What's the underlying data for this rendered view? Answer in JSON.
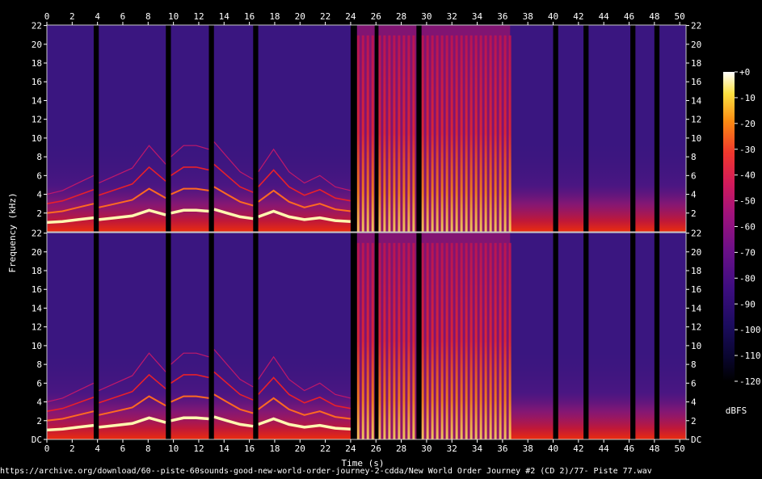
{
  "chart_data": {
    "type": "heatmap",
    "xlabel": "Time (s)",
    "ylabel": "Frequency (kHz)",
    "colorbar_label": "dBFS",
    "xlim": [
      0,
      50.5
    ],
    "ylim": [
      0,
      22.05
    ],
    "x_ticks": [
      "0",
      "2",
      "4",
      "6",
      "8",
      "10",
      "12",
      "14",
      "16",
      "18",
      "20",
      "22",
      "24",
      "26",
      "28",
      "30",
      "32",
      "34",
      "36",
      "38",
      "40",
      "42",
      "44",
      "46",
      "48",
      "50"
    ],
    "y_ticks": [
      "DC",
      "2",
      "4",
      "6",
      "8",
      "10",
      "12",
      "14",
      "16",
      "18",
      "20",
      "22"
    ],
    "colorbar_ticks": [
      "+0",
      "-10",
      "-20",
      "-30",
      "-40",
      "-50",
      "-60",
      "-70",
      "-80",
      "-90",
      "-100",
      "-110",
      "-120"
    ],
    "colorbar_range": [
      -120,
      0
    ],
    "channels": [
      "left",
      "right"
    ],
    "silence_gaps_s": [
      [
        3.7,
        4.1
      ],
      [
        9.4,
        9.8
      ],
      [
        12.8,
        13.2
      ],
      [
        16.3,
        16.7
      ],
      [
        24.0,
        24.5
      ],
      [
        25.9,
        26.2
      ],
      [
        29.2,
        29.6
      ],
      [
        40.0,
        40.4
      ],
      [
        42.4,
        42.8
      ],
      [
        46.1,
        46.5
      ],
      [
        48.0,
        48.4
      ]
    ],
    "pulse_regions_s": [
      [
        24.5,
        25.9
      ],
      [
        26.2,
        29.2
      ],
      [
        29.6,
        36.6
      ]
    ],
    "harmonic_curves": [
      {
        "from_s": 0.0,
        "to_s": 3.7,
        "f0_khz": [
          1.0,
          1.1,
          1.3,
          1.5
        ]
      },
      {
        "from_s": 4.1,
        "to_s": 9.4,
        "f0_khz": [
          1.3,
          1.5,
          1.7,
          2.3,
          1.8
        ]
      },
      {
        "from_s": 9.8,
        "to_s": 12.8,
        "f0_khz": [
          2.0,
          2.3,
          2.3,
          2.2
        ]
      },
      {
        "from_s": 13.2,
        "to_s": 16.3,
        "f0_khz": [
          2.4,
          2.0,
          1.6,
          1.4
        ]
      },
      {
        "from_s": 16.7,
        "to_s": 24.0,
        "f0_khz": [
          1.6,
          2.2,
          1.6,
          1.3,
          1.5,
          1.2,
          1.1
        ]
      }
    ]
  },
  "caption": "https://archive.org/download/60--piste-60sounds-good-new-world-order-journey-2-cdda/New World Order Journey #2 (CD 2)/77- Piste 77.wav"
}
